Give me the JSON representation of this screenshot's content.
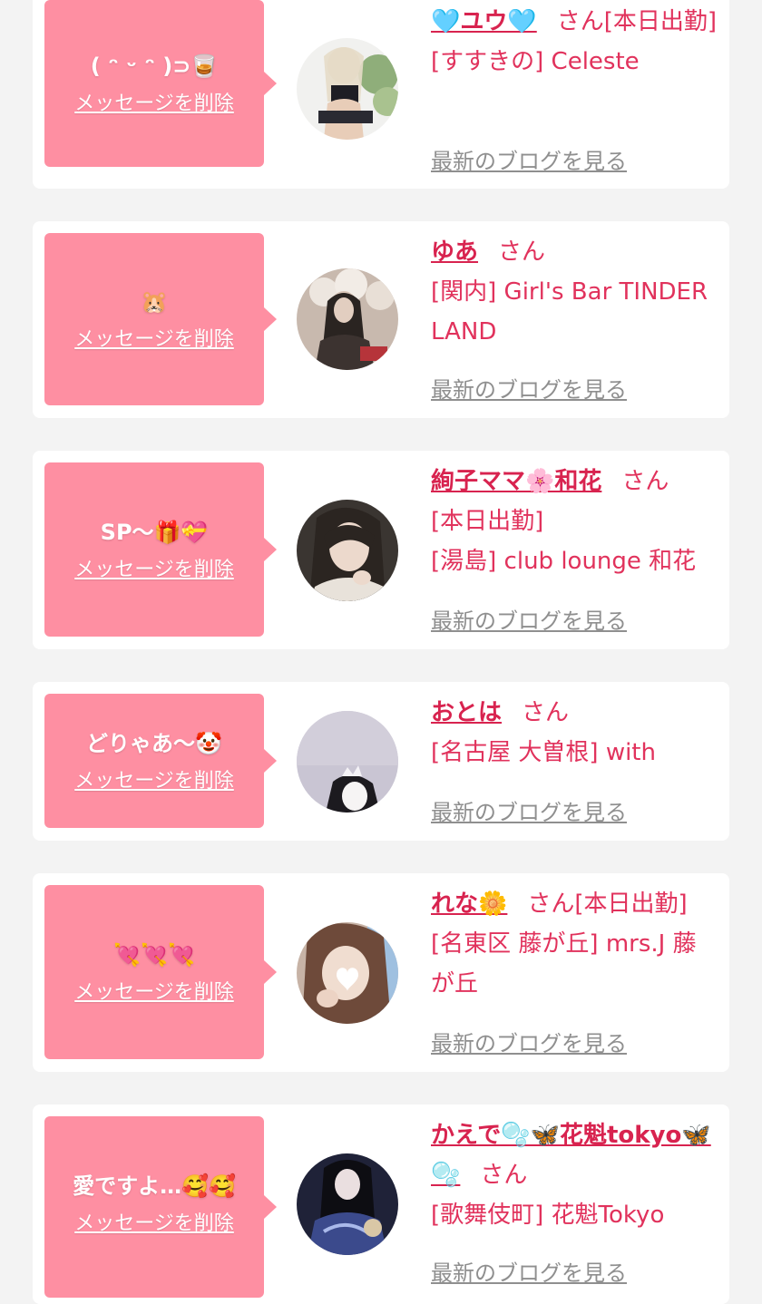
{
  "delete_label": "メッセージを削除",
  "blog_label": "最新のブログを見る",
  "san_label": "さん",
  "colors": {
    "page_bg": "#f3f3f3",
    "bubble": "#fe8fa2",
    "name": "#d8234f",
    "text": "#e1325c",
    "link_gray": "#8f8f8f"
  },
  "cards": [
    {
      "message": "( ᵔ ᵕ ᵔ )⊃🥃",
      "name": "🩵ユウ🩵",
      "suffix": "[本日出勤]",
      "shop": "[すすきの] Celeste",
      "avatar": "photo-woman-1"
    },
    {
      "message": "🐹",
      "name": "ゆあ",
      "suffix": "",
      "shop": "[関内] Girl's Bar TINDER LAND",
      "avatar": "photo-woman-2"
    },
    {
      "message": "SP〜🎁💝",
      "name": "絢子ママ🌸和花",
      "suffix": "[本日出勤]",
      "shop": "[湯島] club lounge 和花",
      "avatar": "photo-woman-3"
    },
    {
      "message": "どりゃあ〜🤡",
      "name": "おとは",
      "suffix": "",
      "shop": "[名古屋 大曽根] with",
      "avatar": "photo-woman-4"
    },
    {
      "message": "💘💘💘",
      "name": "れな🌼",
      "suffix": "[本日出勤]",
      "shop": "[名東区 藤が丘] mrs.J 藤が丘",
      "avatar": "photo-woman-5"
    },
    {
      "message": "愛ですよ…🥰🥰",
      "name": "かえで🫧🦋花魁tokyo🦋🫧",
      "suffix": "",
      "shop": "[歌舞伎町] 花魁Tokyo",
      "avatar": "photo-woman-6"
    }
  ]
}
